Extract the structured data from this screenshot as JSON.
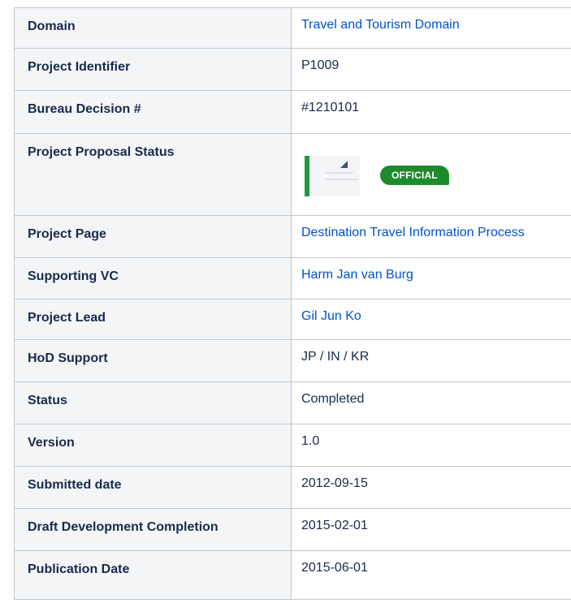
{
  "rows": [
    {
      "key": "Domain",
      "value": "Travel and Tourism Domain",
      "link": true
    },
    {
      "key": "Project Identifier",
      "value": "P1009",
      "link": false
    },
    {
      "key": "Bureau Decision #",
      "value": "#1210101",
      "link": false
    },
    {
      "key": "Project Proposal Status",
      "badge": "OFFICIAL"
    },
    {
      "key": "Project Page",
      "value": "Destination Travel Information Process",
      "link": true
    },
    {
      "key": "Supporting VC",
      "value": "Harm Jan van Burg",
      "link": true
    },
    {
      "key": "Project Lead",
      "value": "Gil Jun Ko",
      "link": true
    },
    {
      "key": "HoD Support",
      "value": "JP / IN / KR",
      "link": false
    },
    {
      "key": "Status",
      "value": "Completed",
      "link": false
    },
    {
      "key": "Version",
      "value": "1.0",
      "link": false
    },
    {
      "key": "Submitted date",
      "value": "2012-09-15",
      "link": false
    },
    {
      "key": "Draft Development Completion",
      "value": "2015-02-01",
      "link": false
    },
    {
      "key": "Publication Date",
      "value": "2015-06-01",
      "link": false
    }
  ],
  "colors": {
    "link": "#0052cc",
    "header_bg": "#f4f5f7",
    "border": "#c1c7d0",
    "badge": "#1e8a2e",
    "doc_accent": "#1e9b3a"
  },
  "icons": {
    "proposal_document": "document-icon"
  }
}
